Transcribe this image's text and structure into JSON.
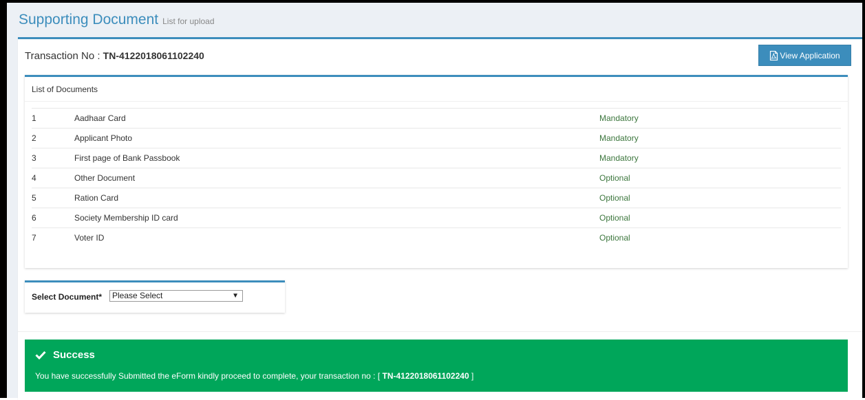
{
  "header": {
    "title": "Supporting Document",
    "subtitle": "List for upload"
  },
  "transaction": {
    "label": "Transaction No :",
    "number": "TN-4122018061102240"
  },
  "view_button": {
    "label": "View Application",
    "icon": "pdf-file-icon"
  },
  "documents": {
    "title": "List of Documents",
    "rows": [
      {
        "no": "1",
        "name": "Aadhaar Card",
        "status": "Mandatory"
      },
      {
        "no": "2",
        "name": "Applicant Photo",
        "status": "Mandatory"
      },
      {
        "no": "3",
        "name": "First page of Bank Passbook",
        "status": "Mandatory"
      },
      {
        "no": "4",
        "name": "Other Document",
        "status": "Optional"
      },
      {
        "no": "5",
        "name": "Ration Card",
        "status": "Optional"
      },
      {
        "no": "6",
        "name": "Society Membership ID card",
        "status": "Optional"
      },
      {
        "no": "7",
        "name": "Voter ID",
        "status": "Optional"
      }
    ]
  },
  "select_document": {
    "label": "Select Document*",
    "selected": "Please Select"
  },
  "success": {
    "title": "Success",
    "message_prefix": "You have successfully Submitted the eForm kindly proceed to complete, your transaction no : [",
    "transaction": "TN-4122018061102240",
    "message_suffix": "]"
  },
  "colors": {
    "primary": "#3c8dbc",
    "success": "#00a65a",
    "status_text": "#3c763d"
  }
}
